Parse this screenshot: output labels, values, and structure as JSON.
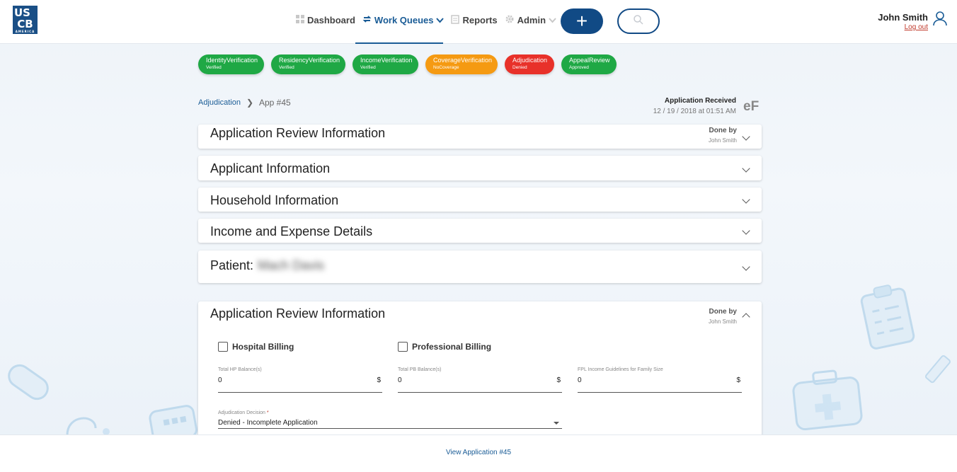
{
  "header": {
    "logo_top": "US",
    "logo_bottom": "CB",
    "logo_sub": "AMERICA",
    "nav": [
      {
        "label": "Dashboard",
        "icon": "dashboard-icon"
      },
      {
        "label": "Work Queues",
        "icon": "refresh-icon"
      },
      {
        "label": "Reports",
        "icon": "reports-icon"
      },
      {
        "label": "Admin",
        "icon": "gear-icon"
      }
    ],
    "add_label": "+",
    "user_name": "John Smith",
    "logout_label": "Log out"
  },
  "pills": [
    {
      "title": "IdentityVerification",
      "status": "Verified",
      "color": "#1fa845"
    },
    {
      "title": "ResidencyVerification",
      "status": "Verified",
      "color": "#1fa845"
    },
    {
      "title": "IncomeVerification",
      "status": "Verified",
      "color": "#1fa845"
    },
    {
      "title": "CoverageVerification",
      "status": "NoCoverage",
      "color": "#f59a12"
    },
    {
      "title": "Adjudication",
      "status": "Denied",
      "color": "#e8312a"
    },
    {
      "title": "AppealReview",
      "status": "Approved",
      "color": "#1fa845"
    }
  ],
  "breadcrumb": {
    "parent": "Adjudication",
    "current": "App #45"
  },
  "received": {
    "title": "Application Received",
    "date": "12 / 19 / 2018 at 01:51 AM"
  },
  "badge": "eF",
  "sections": [
    {
      "title": "Application Review Information",
      "done_by_label": "Done by",
      "done_by": "John Smith"
    },
    {
      "title": "Applicant Information"
    },
    {
      "title": "Household Information"
    },
    {
      "title": "Income and Expense Details"
    },
    {
      "title": "Patient:",
      "hidden_value": "Mach Davis"
    }
  ],
  "review": {
    "title": "Application Review Information",
    "done_by_label": "Done by",
    "done_by": "John Smith",
    "hospital_billing": "Hospital Billing",
    "professional_billing": "Professional Billing",
    "fields": [
      {
        "label": "Total HP Balance(s)",
        "value": "0",
        "unit": "$"
      },
      {
        "label": "Total PB Balance(s)",
        "value": "0",
        "unit": "$"
      },
      {
        "label": "FPL Income Guidelines for Family Size",
        "value": "0",
        "unit": "$"
      }
    ],
    "decision_label": "Adjudication Decision",
    "decision_required": "*",
    "decision_value": "Denied - Incomplete Application"
  },
  "footer": {
    "link": "View Application #45"
  }
}
